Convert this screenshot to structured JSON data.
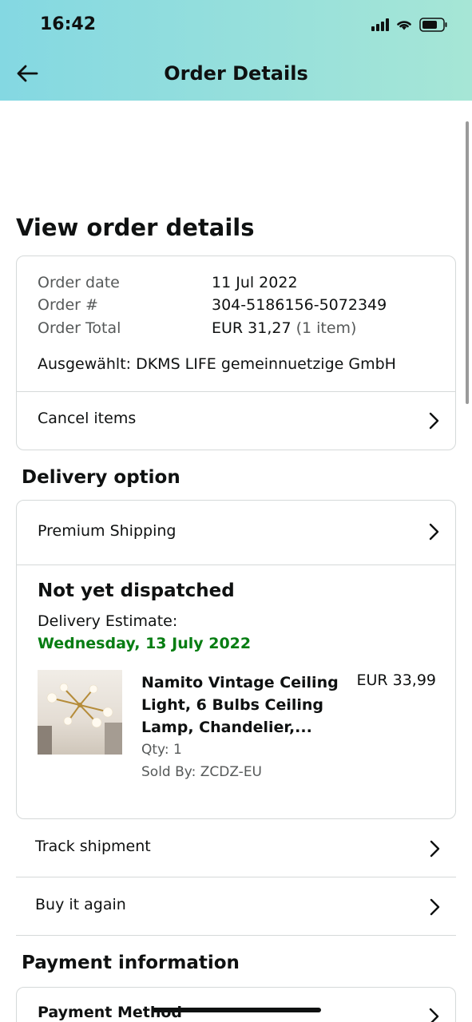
{
  "status_bar": {
    "time": "16:42"
  },
  "nav": {
    "title": "Order Details"
  },
  "page_title": "View order details",
  "order_summary": {
    "order_date_label": "Order date",
    "order_date_value": "11 Jul 2022",
    "order_number_label": "Order #",
    "order_number_value": "304-5186156-5072349",
    "order_total_label": "Order Total",
    "order_total_value": "EUR 31,27",
    "order_total_items": "(1 item)",
    "selected_charity": "Ausgewählt: DKMS LIFE gemeinnuetzige GmbH",
    "cancel_items_label": "Cancel items"
  },
  "delivery": {
    "section_title": "Delivery option",
    "shipping_option": "Premium Shipping",
    "status_title": "Not yet dispatched",
    "estimate_label": "Delivery Estimate:",
    "estimate_date": "Wednesday, 13 July 2022",
    "estimate_color": "#067d12",
    "product": {
      "name": "Namito Vintage Ceiling Light, 6 Bulbs Ceiling Lamp, Chandelier,...",
      "price": "EUR 33,99",
      "qty": "Qty: 1",
      "seller": "Sold By: ZCDZ-EU"
    }
  },
  "actions": {
    "track_shipment": "Track shipment",
    "buy_again": "Buy it again"
  },
  "payment": {
    "section_title": "Payment information",
    "method_label": "Payment Method"
  },
  "colors": {
    "header_gradient_start": "#84d8e2",
    "header_gradient_end": "#a6e6d6",
    "border": "#d5d9d9"
  }
}
